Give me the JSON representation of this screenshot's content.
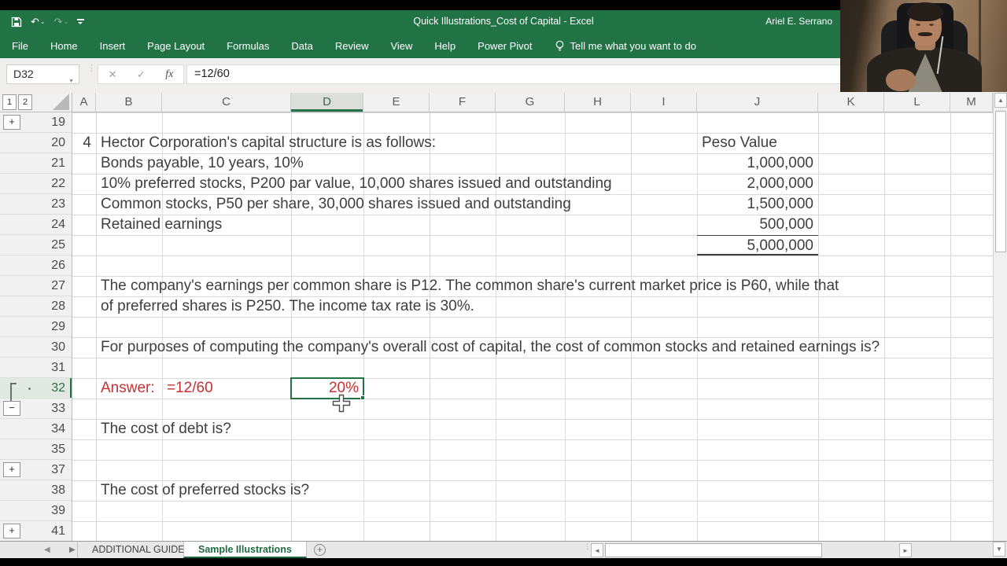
{
  "titlebar": {
    "title": "Quick Illustrations_Cost of Capital  -  Excel",
    "user": "Ariel E. Serrano"
  },
  "ribbon": {
    "tabs": [
      "File",
      "Home",
      "Insert",
      "Page Layout",
      "Formulas",
      "Data",
      "Review",
      "View",
      "Help",
      "Power Pivot"
    ],
    "tell_me": "Tell me what you want to do"
  },
  "formula_bar": {
    "cell_reference": "D32",
    "formula": "=12/60",
    "cancel_glyph": "✕",
    "enter_glyph": "✓",
    "fx_label": "fx"
  },
  "grid": {
    "columns": [
      "A",
      "B",
      "C",
      "D",
      "E",
      "F",
      "G",
      "H",
      "I",
      "J",
      "K",
      "L",
      "M"
    ],
    "rows": [
      "19",
      "20",
      "21",
      "22",
      "23",
      "24",
      "25",
      "26",
      "27",
      "28",
      "29",
      "30",
      "31",
      "32",
      "33",
      "34",
      "35",
      "37",
      "38",
      "39",
      "41"
    ],
    "selected": {
      "col": "D",
      "row": "32"
    },
    "outline": {
      "levels": [
        "1",
        "2"
      ],
      "plus_rows": [
        "19",
        "37",
        "41"
      ],
      "minus_rows": [
        "33"
      ],
      "bracket_rows": [
        "32"
      ]
    },
    "cells": [
      {
        "row": "20",
        "col": "A",
        "text": "4",
        "align": "right"
      },
      {
        "row": "20",
        "col": "B",
        "text": "Hector Corporation's capital structure is as follows:"
      },
      {
        "row": "20",
        "col": "J",
        "text": "Peso Value"
      },
      {
        "row": "21",
        "col": "B",
        "text": "Bonds payable, 10 years, 10%"
      },
      {
        "row": "21",
        "col": "J",
        "text": "1,000,000",
        "align": "right"
      },
      {
        "row": "22",
        "col": "B",
        "text": "10% preferred stocks, P200 par value, 10,000 shares issued and outstanding"
      },
      {
        "row": "22",
        "col": "J",
        "text": "2,000,000",
        "align": "right"
      },
      {
        "row": "23",
        "col": "B",
        "text": "Common stocks, P50 per share, 30,000 shares issued and outstanding"
      },
      {
        "row": "23",
        "col": "J",
        "text": "1,500,000",
        "align": "right"
      },
      {
        "row": "24",
        "col": "B",
        "text": "Retained earnings"
      },
      {
        "row": "24",
        "col": "J",
        "text": "500,000",
        "align": "right"
      },
      {
        "row": "25",
        "col": "J",
        "text": "5,000,000",
        "align": "right",
        "style": "total"
      },
      {
        "row": "27",
        "col": "B",
        "text": "The company's earnings per common share is P12. The common share's current market price is P60, while that"
      },
      {
        "row": "28",
        "col": "B",
        "text": "of preferred shares is P250. The income tax rate is 30%."
      },
      {
        "row": "30",
        "col": "B",
        "text": "For purposes of computing the company's overall cost of capital, the cost of common stocks and retained earnings is?"
      },
      {
        "row": "32",
        "col": "B",
        "text": "Answer:",
        "color": "red"
      },
      {
        "row": "32",
        "col": "C",
        "text": "=12/60",
        "color": "red"
      },
      {
        "row": "32",
        "col": "D",
        "text": "20%",
        "color": "red",
        "align": "right"
      },
      {
        "row": "34",
        "col": "B",
        "text": "The cost of debt is?"
      },
      {
        "row": "38",
        "col": "B",
        "text": "The cost of preferred stocks is?"
      }
    ]
  },
  "sheet_bar": {
    "tabs": [
      {
        "label": "ADDITIONAL GUIDE",
        "active": false
      },
      {
        "label": "Sample Illustrations",
        "active": true
      }
    ],
    "add_label": "+"
  },
  "icons": {
    "undo": "↶",
    "redo": "↷",
    "caret": "⌄",
    "name_box_arrow": "▼",
    "dots": "⋮",
    "up_arrow": "▲",
    "down_arrow": "▼",
    "left_arrow": "◄",
    "right_arrow": "►",
    "nav_left": "◀",
    "nav_right": "▶"
  },
  "colors": {
    "excel_green": "#217346",
    "red_text": "#c63131",
    "grid_line": "#d8d8d8",
    "header_bg": "#f1f1f1"
  }
}
